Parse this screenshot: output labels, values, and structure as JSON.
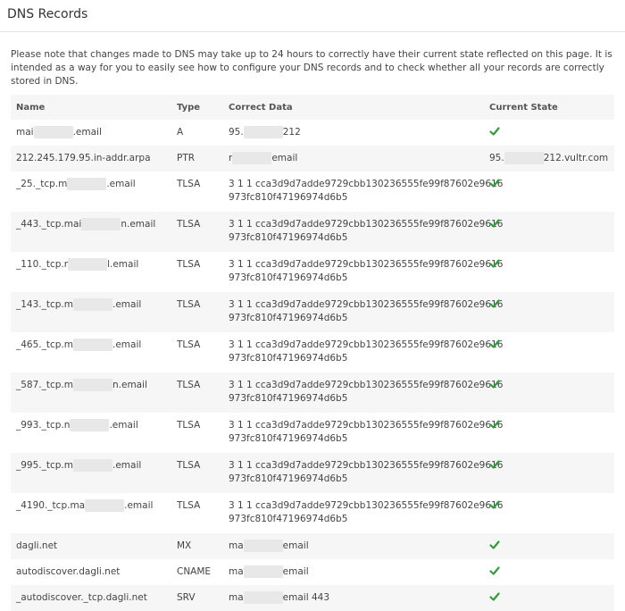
{
  "page": {
    "title": "DNS Records",
    "note": "Please note that changes made to DNS may take up to 24 hours to correctly have their current state reflected on this page. It is intended as a way for you to easily see how to configure your DNS records and to check whether all your records are correctly stored in DNS."
  },
  "table": {
    "headers": {
      "name": "Name",
      "type": "Type",
      "correct": "Correct Data",
      "current": "Current State"
    },
    "rows": [
      {
        "name_pre": "mai",
        "name_post": ".email",
        "type": "A",
        "data_pre": "95.",
        "data_post": "212",
        "state": "check"
      },
      {
        "name_pre": "212.245.179.95.in-addr.arpa",
        "name_post": "",
        "type": "PTR",
        "data_pre": "r",
        "data_post": "email",
        "state_pre": "95.",
        "state_post": "212.vultr.com"
      },
      {
        "name_pre": "_25._tcp.m",
        "name_post": ".email",
        "type": "TLSA",
        "data_line1": "3 1 1 cca3d9d7adde9729cbb130236555fe99f87602e9616",
        "data_line2": "973fc810f47196974d6b5",
        "state": "check"
      },
      {
        "name_pre": "_443._tcp.mai",
        "name_post": "n.email",
        "type": "TLSA",
        "data_line1": "3 1 1 cca3d9d7adde9729cbb130236555fe99f87602e9616",
        "data_line2": "973fc810f47196974d6b5",
        "state": "check"
      },
      {
        "name_pre": "_110._tcp.r",
        "name_post": "l.email",
        "type": "TLSA",
        "data_line1": "3 1 1 cca3d9d7adde9729cbb130236555fe99f87602e9616",
        "data_line2": "973fc810f47196974d6b5",
        "state": "check"
      },
      {
        "name_pre": "_143._tcp.m",
        "name_post": ".email",
        "type": "TLSA",
        "data_line1": "3 1 1 cca3d9d7adde9729cbb130236555fe99f87602e9616",
        "data_line2": "973fc810f47196974d6b5",
        "state": "check"
      },
      {
        "name_pre": "_465._tcp.m",
        "name_post": ".email",
        "type": "TLSA",
        "data_line1": "3 1 1 cca3d9d7adde9729cbb130236555fe99f87602e9616",
        "data_line2": "973fc810f47196974d6b5",
        "state": "check"
      },
      {
        "name_pre": "_587._tcp.m",
        "name_post": "n.email",
        "type": "TLSA",
        "data_line1": "3 1 1 cca3d9d7adde9729cbb130236555fe99f87602e9616",
        "data_line2": "973fc810f47196974d6b5",
        "state": "check"
      },
      {
        "name_pre": "_993._tcp.n",
        "name_post": ".email",
        "type": "TLSA",
        "data_line1": "3 1 1 cca3d9d7adde9729cbb130236555fe99f87602e9616",
        "data_line2": "973fc810f47196974d6b5",
        "state": "check"
      },
      {
        "name_pre": "_995._tcp.m",
        "name_post": ".email",
        "type": "TLSA",
        "data_line1": "3 1 1 cca3d9d7adde9729cbb130236555fe99f87602e9616",
        "data_line2": "973fc810f47196974d6b5",
        "state": "check"
      },
      {
        "name_pre": "_4190._tcp.ma",
        "name_post": ".email",
        "type": "TLSA",
        "data_line1": "3 1 1 cca3d9d7adde9729cbb130236555fe99f87602e9616",
        "data_line2": "973fc810f47196974d6b5",
        "state": "check"
      },
      {
        "name_pre": "dagli.net",
        "name_post": "",
        "type": "MX",
        "data_pre": "ma",
        "data_post": "email",
        "state": "check"
      },
      {
        "name_pre": "autodiscover.dagli.net",
        "name_post": "",
        "type": "CNAME",
        "data_pre": "ma",
        "data_post": "email",
        "state": "check"
      },
      {
        "name_pre": "_autodiscover._tcp.dagli.net",
        "name_post": "",
        "type": "SRV",
        "data_pre": "ma",
        "data_post": "email 443",
        "state": "check"
      }
    ]
  },
  "colors": {
    "check": "#2e9e3a",
    "stripe": "#f6f6f6",
    "redaction": "#e8e8e8"
  },
  "icons": {
    "check": "checkmark-icon"
  }
}
